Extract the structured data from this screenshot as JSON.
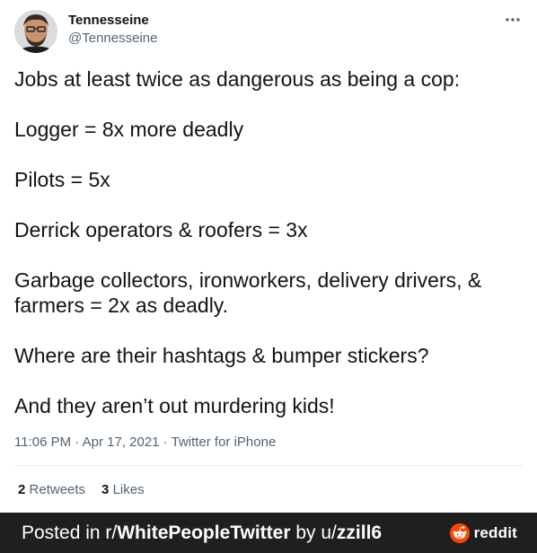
{
  "tweet": {
    "author": {
      "display_name": "Tennesseine",
      "handle": "@Tennesseine"
    },
    "more_icon": "ellipsis-icon",
    "paragraphs": [
      "Jobs at least twice as dangerous as being a cop:",
      "Logger = 8x more deadly",
      "Pilots = 5x",
      "Derrick operators & roofers = 3x",
      "Garbage collectors, ironworkers, delivery drivers, & farmers = 2x as deadly.",
      "Where are their hashtags & bumper stickers?",
      "And they aren’t out murdering kids!"
    ],
    "time": "11:06 PM",
    "separator": " · ",
    "date": "Apr 17, 2021",
    "source": "Twitter for iPhone",
    "stats": {
      "retweets_count": "2",
      "retweets_label": "Retweets",
      "likes_count": "3",
      "likes_label": "Likes"
    }
  },
  "footer": {
    "prefix": "Posted in r/",
    "subreddit": "WhitePeopleTwitter",
    "by": " by u/",
    "username": "zzill6",
    "logo_icon": "reddit-alien-icon",
    "logo_text": "reddit"
  },
  "colors": {
    "text_primary": "#0f1419",
    "text_secondary": "#536471",
    "divider": "#e6ecf0",
    "footer_bg": "#1f1f1f",
    "reddit_orange": "#ff4500"
  }
}
